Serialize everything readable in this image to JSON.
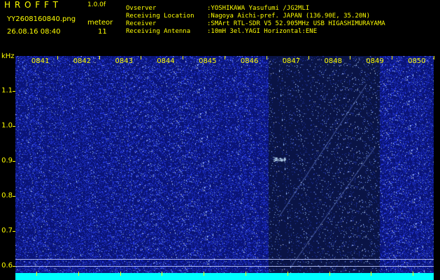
{
  "header": {
    "app_title": "H R O F F T",
    "version": "1.0.0f",
    "filename": "YY2608160840.png",
    "datetime": "26.08.16 08:40",
    "mode_label": "meteor",
    "meteor_count": "11",
    "info_lines": [
      {
        "label": "Ovserver",
        "value": ":YOSHIKAWA Yasufumi /JG2MLI"
      },
      {
        "label": "Receiving Location",
        "value": ":Nagoya Aichi-pref. JAPAN (136.90E, 35.20N)"
      },
      {
        "label": "Receiver",
        "value": ":SMArt RTL-SDR V5 52.905MHz USB HIGASHIMURAYAMA"
      },
      {
        "label": "Receiving Antenna",
        "value": ":10mH 3el.YAGI Horizontal:ENE"
      }
    ]
  },
  "chart_data": {
    "type": "heatmap",
    "y_unit": "kHz",
    "y_ticks": [
      "1.1",
      "1.0",
      "0.9",
      "0.8",
      "0.7",
      "0.6"
    ],
    "x_ticks": [
      "0841",
      "0842",
      "0843",
      "0844",
      "0845",
      "0846",
      "0847",
      "0848",
      "0849",
      "0850"
    ],
    "ylim": [
      0.58,
      1.2
    ],
    "events": [
      {
        "time_minute": 6.75,
        "freq_khz": 0.905,
        "kind": "meteor-burst"
      }
    ],
    "colors": {
      "background": "#000000",
      "noise": "#1a2fd0",
      "signal": "#c8e8ff",
      "labels": "#ffff00",
      "baseline": "#00ffff"
    }
  }
}
